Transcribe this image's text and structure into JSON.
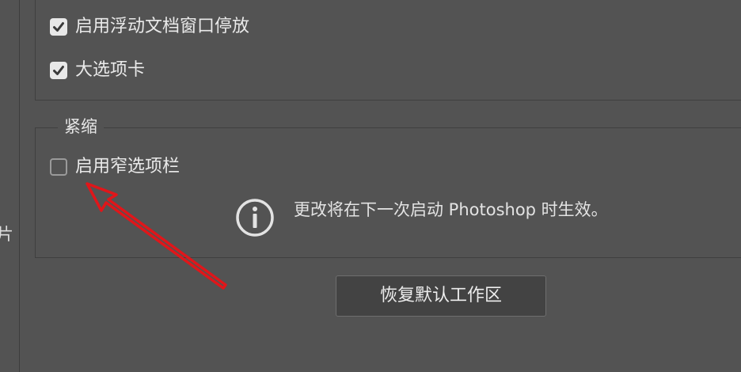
{
  "side_rail": {
    "label": "片"
  },
  "docking_panel": {
    "options": [
      {
        "label": "启用浮动文档窗口停放",
        "checked": true
      },
      {
        "label": "大选项卡",
        "checked": true
      }
    ]
  },
  "compact_group": {
    "title": "紧缩",
    "option": {
      "label": "启用窄选项栏",
      "checked": false
    }
  },
  "notice": {
    "icon": "info-icon",
    "text": "更改将在下一次启动 Photoshop 时生效。"
  },
  "reset_button": {
    "label": "恢复默认工作区"
  },
  "annotation": {
    "icon": "arrow-icon",
    "color": "#e0161a"
  },
  "colors": {
    "background": "#535353",
    "text": "#e6e6e6",
    "button_bg": "#434343",
    "checkbox_checked": "#e8e8e8"
  }
}
